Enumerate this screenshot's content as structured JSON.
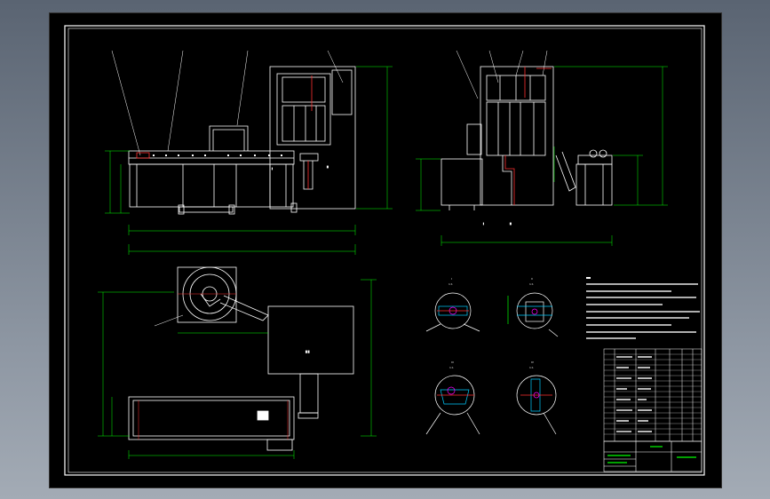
{
  "drawing": {
    "type": "engineering-assembly-drawing",
    "colors": {
      "background": "#000000",
      "outline": "#ffffff",
      "dimension": "#00ff00",
      "centerline": "#ff3030",
      "accent": "#ff00ff",
      "frame": "#ffffff"
    },
    "views": [
      "front-view",
      "side-view",
      "top-view",
      "detail-I",
      "detail-II",
      "detail-III",
      "detail-IV",
      "technical-notes",
      "parts-list",
      "title-block"
    ],
    "detail_titles": [
      "I",
      "II",
      "III",
      "IV"
    ],
    "scale_note": "1:1"
  }
}
